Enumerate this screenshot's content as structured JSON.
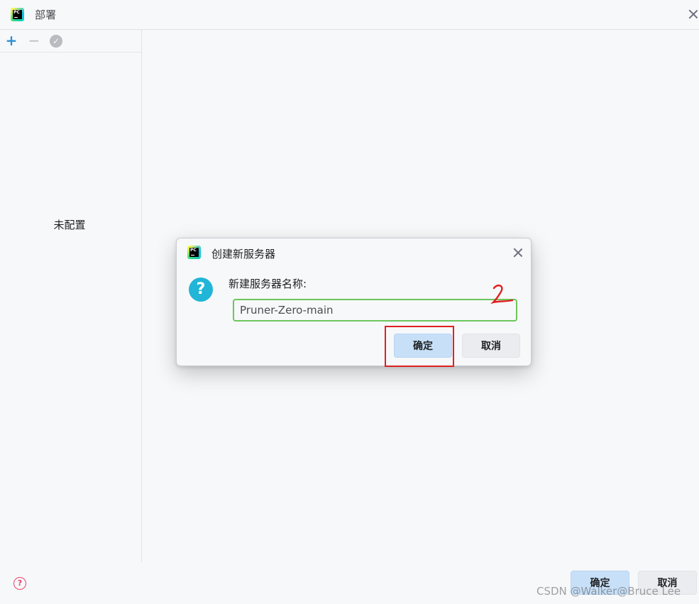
{
  "window": {
    "title": "部署"
  },
  "sidebar": {
    "empty_text": "未配置",
    "add_symbol": "+",
    "remove_symbol": "−",
    "check_symbol": "✓"
  },
  "footer": {
    "ok_label": "确定",
    "cancel_label": "取消",
    "watermark": "CSDN @Walker@Bruce Lee"
  },
  "dialog": {
    "title": "创建新服务器",
    "prompt": "新建服务器名称:",
    "input_value": "Pruner-Zero-main",
    "ok_label": "确定",
    "cancel_label": "取消",
    "annotation": "2"
  },
  "icons": {
    "app": "pycharm-logo-icon",
    "help": "help-icon",
    "question": "question-icon"
  },
  "colors": {
    "accent": "#2f8fd1",
    "primary_button": "#c7e0f8",
    "input_border_valid": "#6cc65c",
    "annotation": "#e02020",
    "question_icon": "#21b5d8"
  }
}
